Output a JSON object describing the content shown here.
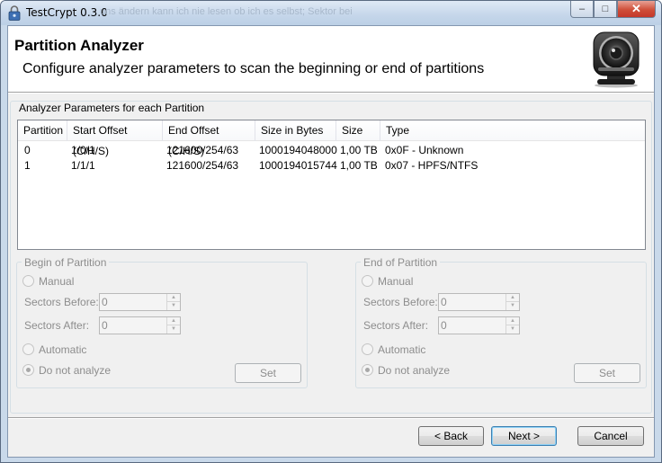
{
  "window": {
    "title": "TestCrypt 0.3.0",
    "title_bg_text": "uns ändern kann ich nie lesen ob ich es selbst; Sektor bei",
    "controls": {
      "minimize": "–",
      "maximize": "□",
      "close": "✕"
    }
  },
  "header": {
    "title": "Partition Analyzer",
    "subtitle": "Configure analyzer parameters to scan the beginning or end of partitions",
    "icon": "webcam-icon"
  },
  "params": {
    "legend": "Analyzer Parameters for each Partition",
    "columns": [
      "Partition",
      "Start Offset (C/H/S)",
      "End Offset (C/H/S)",
      "Size in Bytes",
      "Size",
      "Type"
    ],
    "rows": [
      [
        "0",
        "1/0/1",
        "121600/254/63",
        "1000194048000",
        "1,00 TB",
        "0x0F - Unknown"
      ],
      [
        "1",
        "1/1/1",
        "121600/254/63",
        "1000194015744",
        "1,00 TB",
        "0x07 - HPFS/NTFS"
      ]
    ]
  },
  "begin": {
    "legend": "Begin of Partition",
    "manual": "Manual",
    "sectors_before": "Sectors Before:",
    "sectors_before_value": "0",
    "sectors_after": "Sectors After:",
    "sectors_after_value": "0",
    "automatic": "Automatic",
    "do_not_analyze": "Do not analyze",
    "set": "Set"
  },
  "end": {
    "legend": "End of Partition",
    "manual": "Manual",
    "sectors_before": "Sectors Before:",
    "sectors_before_value": "0",
    "sectors_after": "Sectors After:",
    "sectors_after_value": "0",
    "automatic": "Automatic",
    "do_not_analyze": "Do not analyze",
    "set": "Set"
  },
  "footer": {
    "back": "< Back",
    "next": "Next >",
    "cancel": "Cancel"
  }
}
